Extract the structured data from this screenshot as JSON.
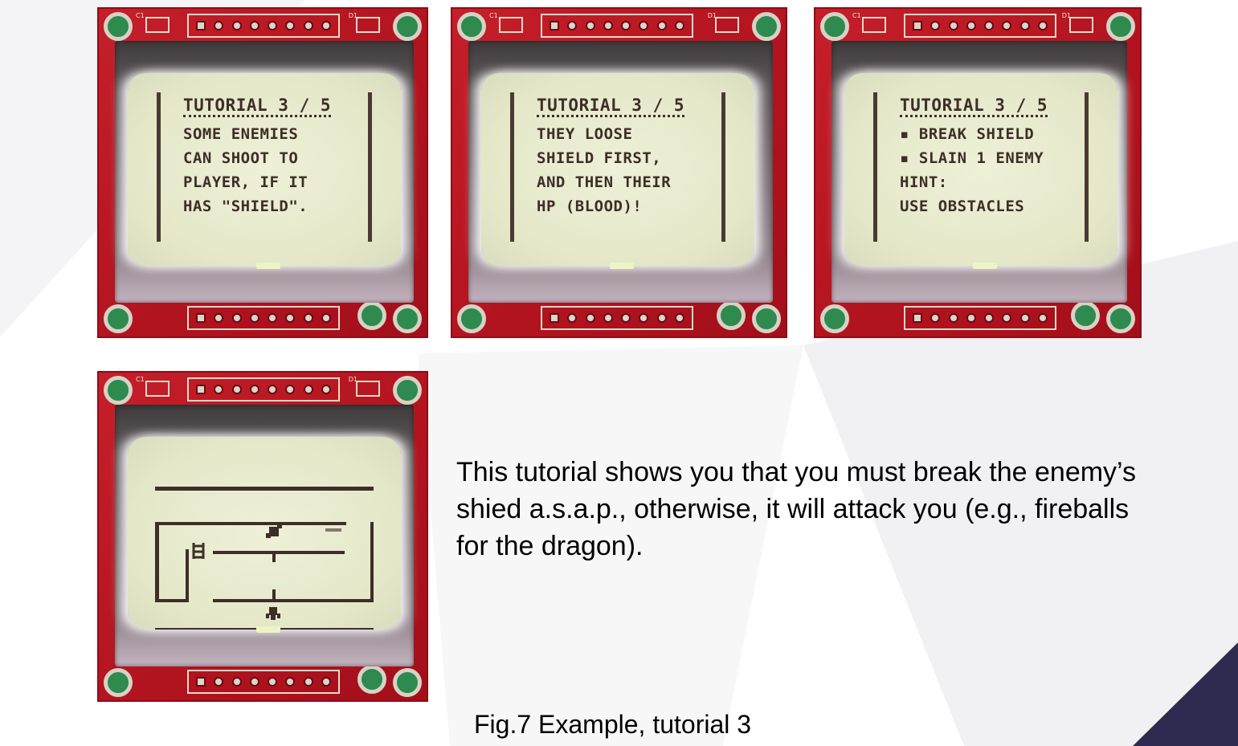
{
  "screens": [
    {
      "title": "TUTORIAL 3 / 5",
      "lines": [
        "SOME ENEMIES",
        "CAN SHOOT TO",
        "PLAYER, IF IT",
        "HAS \"SHIELD\"."
      ]
    },
    {
      "title": "TUTORIAL 3 / 5",
      "lines": [
        "THEY LOOSE",
        "SHIELD FIRST,",
        "AND THEN THEIR",
        "HP (BLOOD)!"
      ]
    },
    {
      "title": "TUTORIAL 3 / 5",
      "lines": [
        "▪ BREAK SHIELD",
        "▪ SLAIN 1 ENEMY",
        "HINT:",
        "USE OBSTACLES"
      ]
    }
  ],
  "board_silkscreen": {
    "c1": "C1",
    "d1": "D1"
  },
  "description": "This tutorial shows you that you must break the enemy’s shied a.s.a.p., otherwise, it will attack you (e.g., fireballs for the dragon).",
  "figure_caption": "Fig.7 Example, tutorial 3",
  "colors": {
    "board_red": "#b2141f",
    "lcd_bg": "#e4e8c8",
    "lcd_ink": "#3d2e28",
    "accent_navy": "#2f2a4f"
  },
  "icons": {
    "player": "player-sprite-icon",
    "enemy": "enemy-sprite-icon",
    "ladder": "ladder-icon"
  }
}
